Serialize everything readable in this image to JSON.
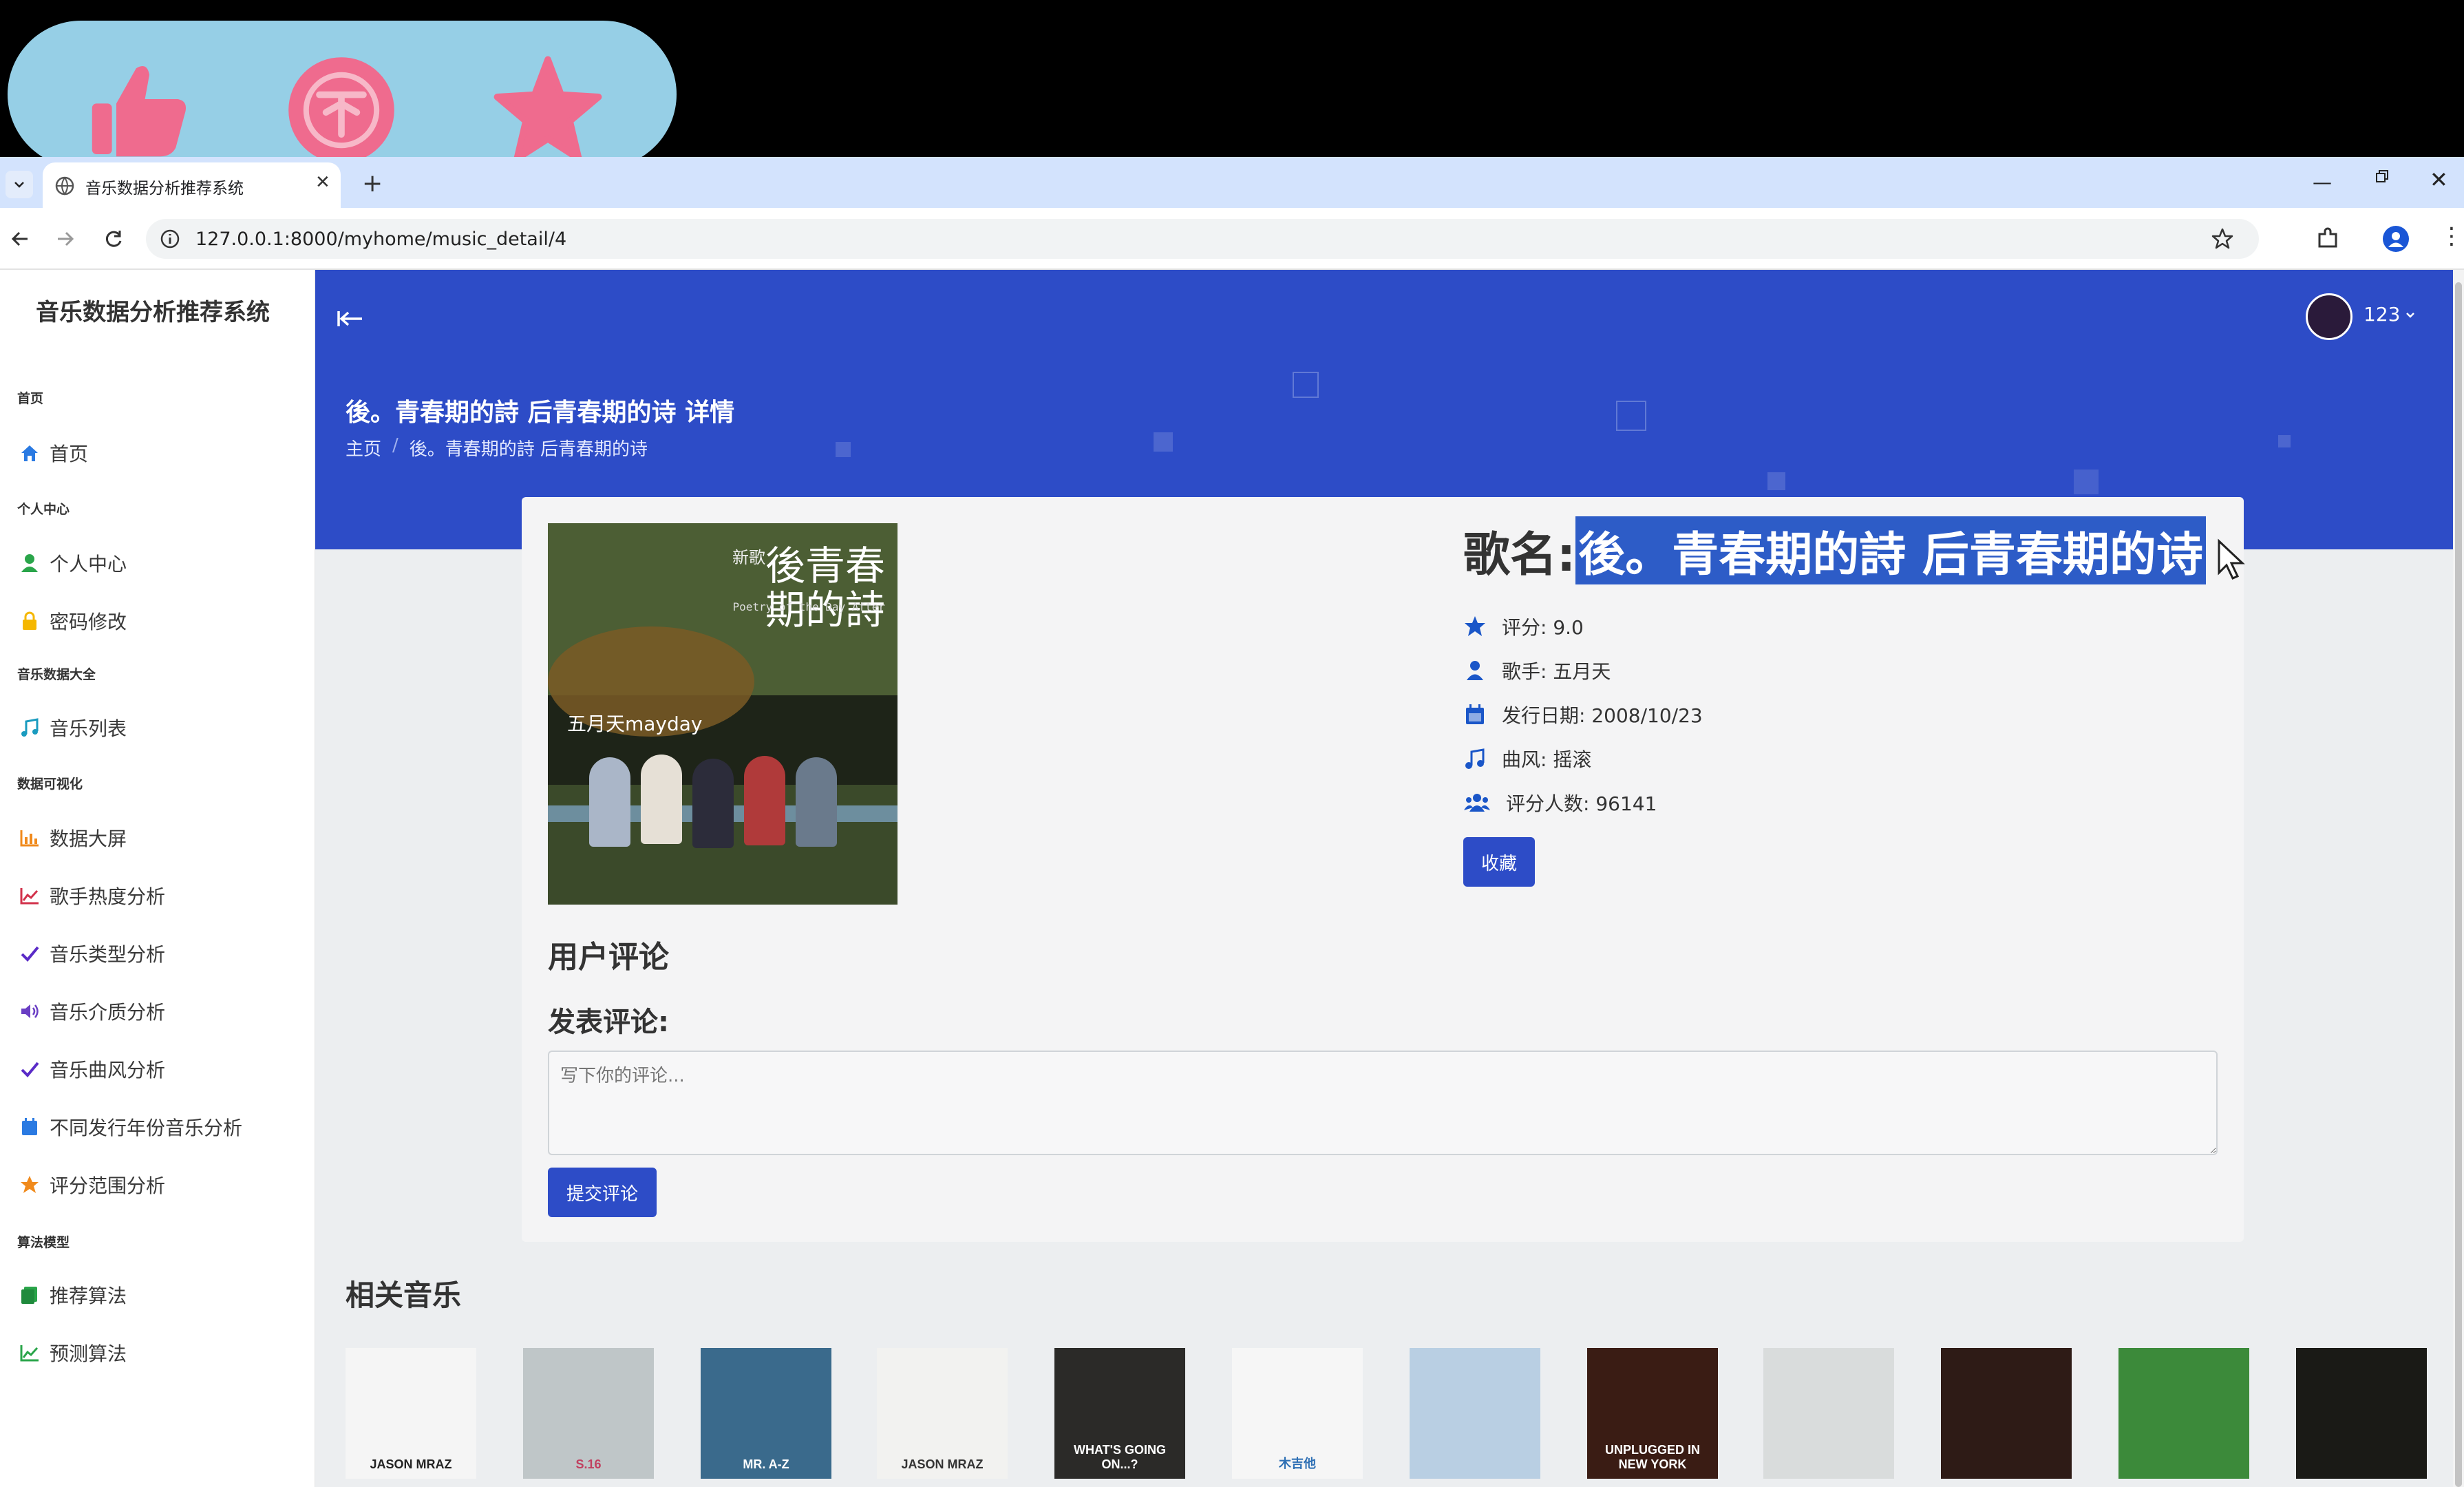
{
  "colors": {
    "primary": "#2d4cc7",
    "overlay": "#96cfe6",
    "accent_pink": "#ef6b8e",
    "selection": "#2d5cc7"
  },
  "overlay_icons": [
    "thumbs-up-icon",
    "coin-icon",
    "star-icon"
  ],
  "browser": {
    "tab_title": "音乐数据分析推荐系统",
    "url": "127.0.0.1:8000/myhome/music_detail/4"
  },
  "sidebar": {
    "brand": "音乐数据分析推荐系统",
    "sections": [
      {
        "header": "首页",
        "items": [
          {
            "label": "首页",
            "icon": "home-icon"
          }
        ]
      },
      {
        "header": "个人中心",
        "items": [
          {
            "label": "个人中心",
            "icon": "user-icon"
          },
          {
            "label": "密码修改",
            "icon": "lock-icon"
          }
        ]
      },
      {
        "header": "音乐数据大全",
        "items": [
          {
            "label": "音乐列表",
            "icon": "music-icon"
          }
        ]
      },
      {
        "header": "数据可视化",
        "items": [
          {
            "label": "数据大屏",
            "icon": "bar-chart-icon"
          },
          {
            "label": "歌手热度分析",
            "icon": "line-chart-icon"
          },
          {
            "label": "音乐类型分析",
            "icon": "check-icon"
          },
          {
            "label": "音乐介质分析",
            "icon": "volume-icon"
          },
          {
            "label": "音乐曲风分析",
            "icon": "check-icon"
          },
          {
            "label": "不同发行年份音乐分析",
            "icon": "calendar-icon"
          },
          {
            "label": "评分范围分析",
            "icon": "star-icon"
          }
        ]
      },
      {
        "header": "算法模型",
        "items": [
          {
            "label": "推荐算法",
            "icon": "book-icon"
          },
          {
            "label": "预测算法",
            "icon": "line-chart-icon"
          }
        ]
      }
    ]
  },
  "header": {
    "user": "123",
    "page_title": "後。青春期的詩 后青春期的诗 详情",
    "breadcrumb": [
      "主页",
      "後。青春期的詩 后青春期的诗"
    ]
  },
  "album": {
    "cover_text_title": "後青春期的詩",
    "cover_text_sub": "Poetry of the Day After",
    "cover_artist": "五月天mayday",
    "cover_label": "新歌",
    "band_colors": [
      "#556a3a",
      "#2e3a22",
      "#1e2418",
      "#6b7a4c"
    ]
  },
  "song": {
    "name_label": "歌名:",
    "name": "後。青春期的詩 后青春期的诗",
    "rating": "评分: 9.0",
    "singer": "歌手: 五月天",
    "release": "发行日期: 2008/10/23",
    "style": "曲风: 摇滚",
    "raters": "评分人数: 96141",
    "fav_button": "收藏"
  },
  "comments": {
    "title": "用户评论",
    "post_label": "发表评论:",
    "placeholder": "写下你的评论...",
    "submit": "提交评论"
  },
  "related": {
    "title": "相关音乐",
    "items": [
      {
        "bg": "#f5f5f5",
        "fg": "#222",
        "text": "JASON MRAZ"
      },
      {
        "bg": "#bfc6c8",
        "fg": "#c14060",
        "text": "S.16"
      },
      {
        "bg": "#3a6a8c",
        "fg": "#fff",
        "text": "MR. A-Z"
      },
      {
        "bg": "#f2f2f0",
        "fg": "#333",
        "text": "JASON MRAZ"
      },
      {
        "bg": "#2b2a28",
        "fg": "#fff",
        "text": "WHAT'S GOING ON...?"
      },
      {
        "bg": "#f6f6f6",
        "fg": "#2d6fb4",
        "text": "木吉他"
      },
      {
        "bg": "#b9cfe3",
        "fg": "#2a2a2a",
        "text": ""
      },
      {
        "bg": "#3a1c14",
        "fg": "#ffffff",
        "text": "UNPLUGGED IN NEW YORK"
      },
      {
        "bg": "#d9dcdc",
        "fg": "#555",
        "text": ""
      },
      {
        "bg": "#2e1b16",
        "fg": "#e9c9b0",
        "text": ""
      },
      {
        "bg": "#3c8a3a",
        "fg": "#e33",
        "text": ""
      },
      {
        "bg": "#1a1a16",
        "fg": "#999",
        "text": ""
      }
    ]
  }
}
